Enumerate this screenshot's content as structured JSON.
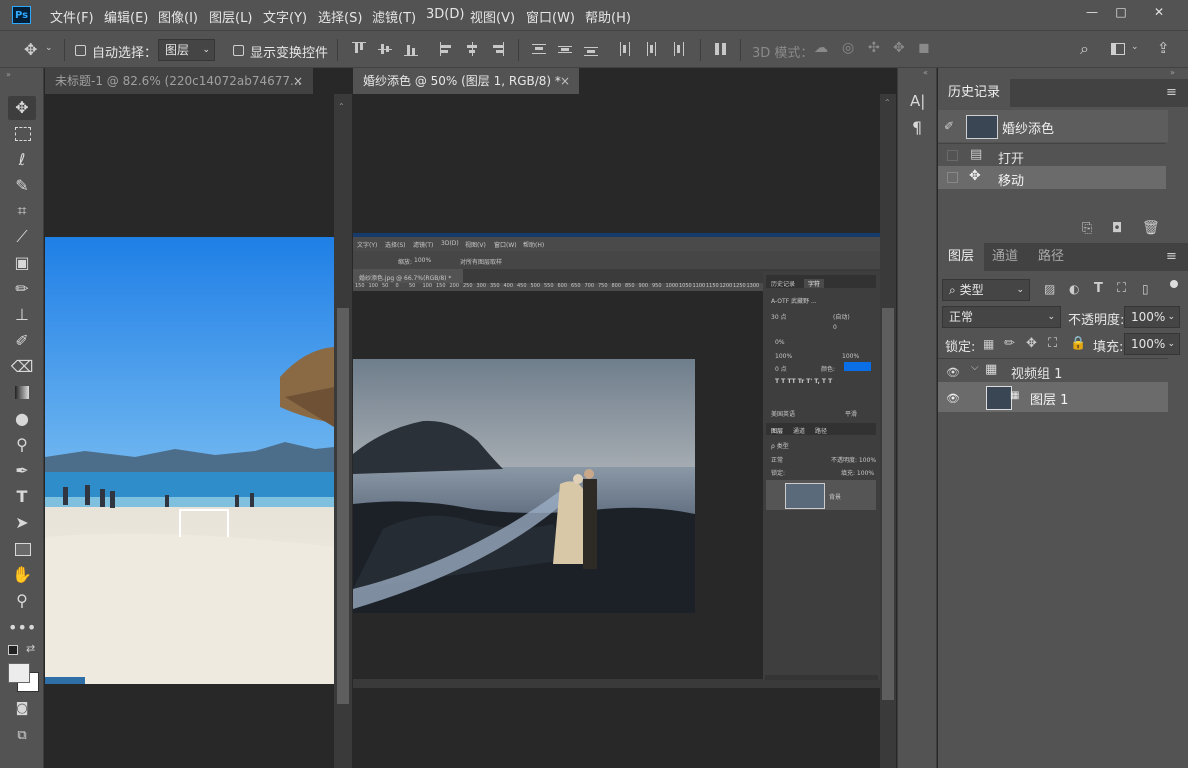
{
  "menu": {
    "logo": "Ps",
    "items": [
      "文件(F)",
      "编辑(E)",
      "图像(I)",
      "图层(L)",
      "文字(Y)",
      "选择(S)",
      "滤镜(T)",
      "3D(D)",
      "视图(V)",
      "窗口(W)",
      "帮助(H)"
    ]
  },
  "window": {
    "minimize": "—",
    "maximize": "□",
    "close": "✕"
  },
  "options": {
    "auto_select_label": "自动选择：",
    "auto_select_value": "图层",
    "show_transform_label": "显示变换控件",
    "mode3d_label": "3D 模式："
  },
  "docs": {
    "tab1": "未标题-1 @ 82.6% (220c14072ab74677...",
    "tab2": "婚纱添色 @ 50% (图层 1, RGB/8) *",
    "close": "×"
  },
  "inner": {
    "menu": [
      "文字(Y)",
      "选择(S)",
      "滤镜(T)",
      "3D(D)",
      "视图(V)",
      "窗口(W)",
      "帮助(H)"
    ],
    "zoom_label": "缩放:",
    "zoom_value": "100%",
    "all_windows": "对所有图层取样",
    "tab": "婚纱添色.jpg @ 66.7%(RGB/8) *",
    "ruler": [
      "150",
      "100",
      "50",
      "0",
      "50",
      "100",
      "150",
      "200",
      "250",
      "300",
      "350",
      "400",
      "450",
      "500",
      "550",
      "600",
      "650",
      "700",
      "750",
      "800",
      "850",
      "900",
      "950",
      "1000",
      "1050",
      "1100",
      "1150",
      "1200",
      "1250",
      "1300"
    ],
    "panel_tabs": [
      "历史记录",
      "字符"
    ],
    "char_font": "A-OTF 武藏野 ...",
    "char_size": "30 点",
    "char_lead": "(自动)",
    "char_kern": "0",
    "char_track": "0%",
    "char_scale_v": "100%",
    "char_scale_h": "100%",
    "char_base": "0 点",
    "char_color_label": "颜色:",
    "char_lang": "美国英语",
    "char_aa": "平滑",
    "layer_tabs": [
      "图层",
      "通道",
      "路径"
    ],
    "layer_kind": "ρ 类型",
    "layer_mode": "正常",
    "layer_opacity": "不透明度: 100%",
    "layer_lock": "锁定:",
    "layer_fill": "填充: 100%",
    "layer_name": "背景"
  },
  "history": {
    "tab": "历史记录",
    "snapshot": "婚纱添色",
    "items": [
      "打开",
      "移动"
    ]
  },
  "layers": {
    "tabs": [
      "图层",
      "通道",
      "路径"
    ],
    "kind": "类型",
    "blend_mode": "正常",
    "opacity_label": "不透明度:",
    "opacity_value": "100%",
    "lock_label": "锁定:",
    "fill_label": "填充:",
    "fill_value": "100%",
    "group_name": "视频组 1",
    "layer_name": "图层 1"
  },
  "mini_panel": {
    "char_glyph": "A|",
    "para_glyph": "¶"
  },
  "colors": {
    "bg": "#282828",
    "panel": "#535353",
    "accent_blue": "#1473e6",
    "char_color": "#0a6fe6"
  }
}
